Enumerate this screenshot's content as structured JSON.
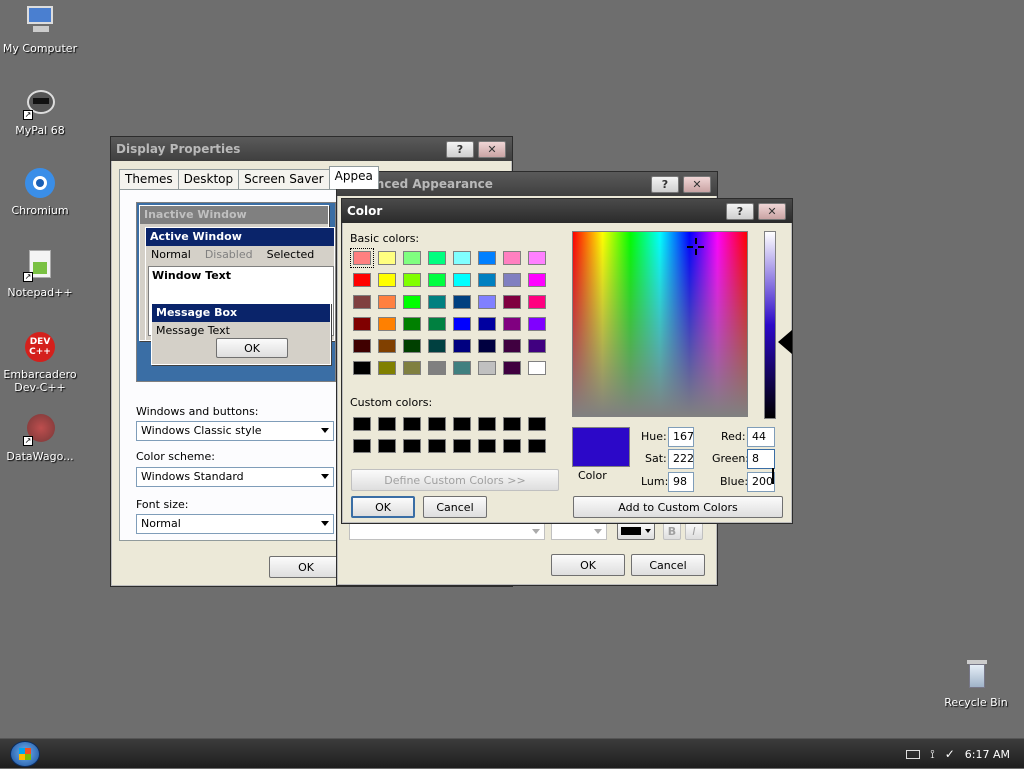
{
  "desktop": {
    "icons": [
      {
        "label": "My Computer",
        "icon": "computer-icon"
      },
      {
        "label": "MyPal 68",
        "icon": "raccoon-browser-icon"
      },
      {
        "label": "Chromium",
        "icon": "chromium-icon"
      },
      {
        "label": "Notepad++",
        "icon": "notepad-plus-icon"
      },
      {
        "label": "Embarcadero Dev-C++",
        "icon": "devcpp-icon"
      },
      {
        "label": "DataWago...",
        "icon": "datawagon-icon"
      },
      {
        "label": "Recycle Bin",
        "icon": "recycle-bin-icon"
      }
    ],
    "devcpp_badge": "DEV C++"
  },
  "display_properties": {
    "title": "Display Properties",
    "tabs": [
      "Themes",
      "Desktop",
      "Screen Saver",
      "Appea"
    ],
    "preview": {
      "inactive_window": "Inactive Window",
      "active_window": "Active Window",
      "menu_normal": "Normal",
      "menu_disabled": "Disabled",
      "menu_selected": "Selected",
      "window_text": "Window Text",
      "message_box": "Message Box",
      "message_text": "Message Text",
      "ok": "OK"
    },
    "windows_buttons_label": "Windows and buttons:",
    "windows_buttons_value": "Windows Classic style",
    "color_scheme_label": "Color scheme:",
    "color_scheme_value": "Windows Standard",
    "font_size_label": "Font size:",
    "font_size_value": "Normal",
    "ok": "OK"
  },
  "advanced_appearance": {
    "title": "Advanced Appearance",
    "ok": "OK",
    "cancel": "Cancel"
  },
  "color_dialog": {
    "title": "Color",
    "basic_colors_label": "Basic colors:",
    "custom_colors_label": "Custom colors:",
    "define_custom": "Define Custom Colors >>",
    "ok": "OK",
    "cancel": "Cancel",
    "add_custom": "Add to Custom Colors",
    "color_solid_label": "Color",
    "hue_label": "Hue:",
    "hue": "167",
    "sat_label": "Sat:",
    "sat": "222",
    "lum_label": "Lum:",
    "lum": "98",
    "red_label": "Red:",
    "red": "44",
    "green_label": "Green:",
    "green": "8",
    "blue_label": "Blue:",
    "blue": "200",
    "current_color": "#2c08c8",
    "basic_colors": [
      [
        "#ff8080",
        "#ffff80",
        "#80ff80",
        "#00ff80",
        "#80ffff",
        "#0080ff",
        "#ff80c0",
        "#ff80ff"
      ],
      [
        "#ff0000",
        "#ffff00",
        "#80ff00",
        "#00ff40",
        "#00ffff",
        "#0080c0",
        "#8080c0",
        "#ff00ff"
      ],
      [
        "#804040",
        "#ff8040",
        "#00ff00",
        "#008080",
        "#004080",
        "#8080ff",
        "#800040",
        "#ff0080"
      ],
      [
        "#800000",
        "#ff8000",
        "#008000",
        "#008040",
        "#0000ff",
        "#0000a0",
        "#800080",
        "#8000ff"
      ],
      [
        "#400000",
        "#804000",
        "#004000",
        "#004040",
        "#000080",
        "#000040",
        "#400040",
        "#400080"
      ],
      [
        "#000000",
        "#808000",
        "#808040",
        "#808080",
        "#408080",
        "#c0c0c0",
        "#400040",
        "#ffffff"
      ]
    ],
    "custom_colors": [
      [
        "#000000",
        "#000000",
        "#000000",
        "#000000",
        "#000000",
        "#000000",
        "#000000",
        "#000000"
      ],
      [
        "#000000",
        "#000000",
        "#000000",
        "#000000",
        "#000000",
        "#000000",
        "#000000",
        "#000000"
      ]
    ]
  },
  "taskbar": {
    "clock": "6:17 AM"
  }
}
